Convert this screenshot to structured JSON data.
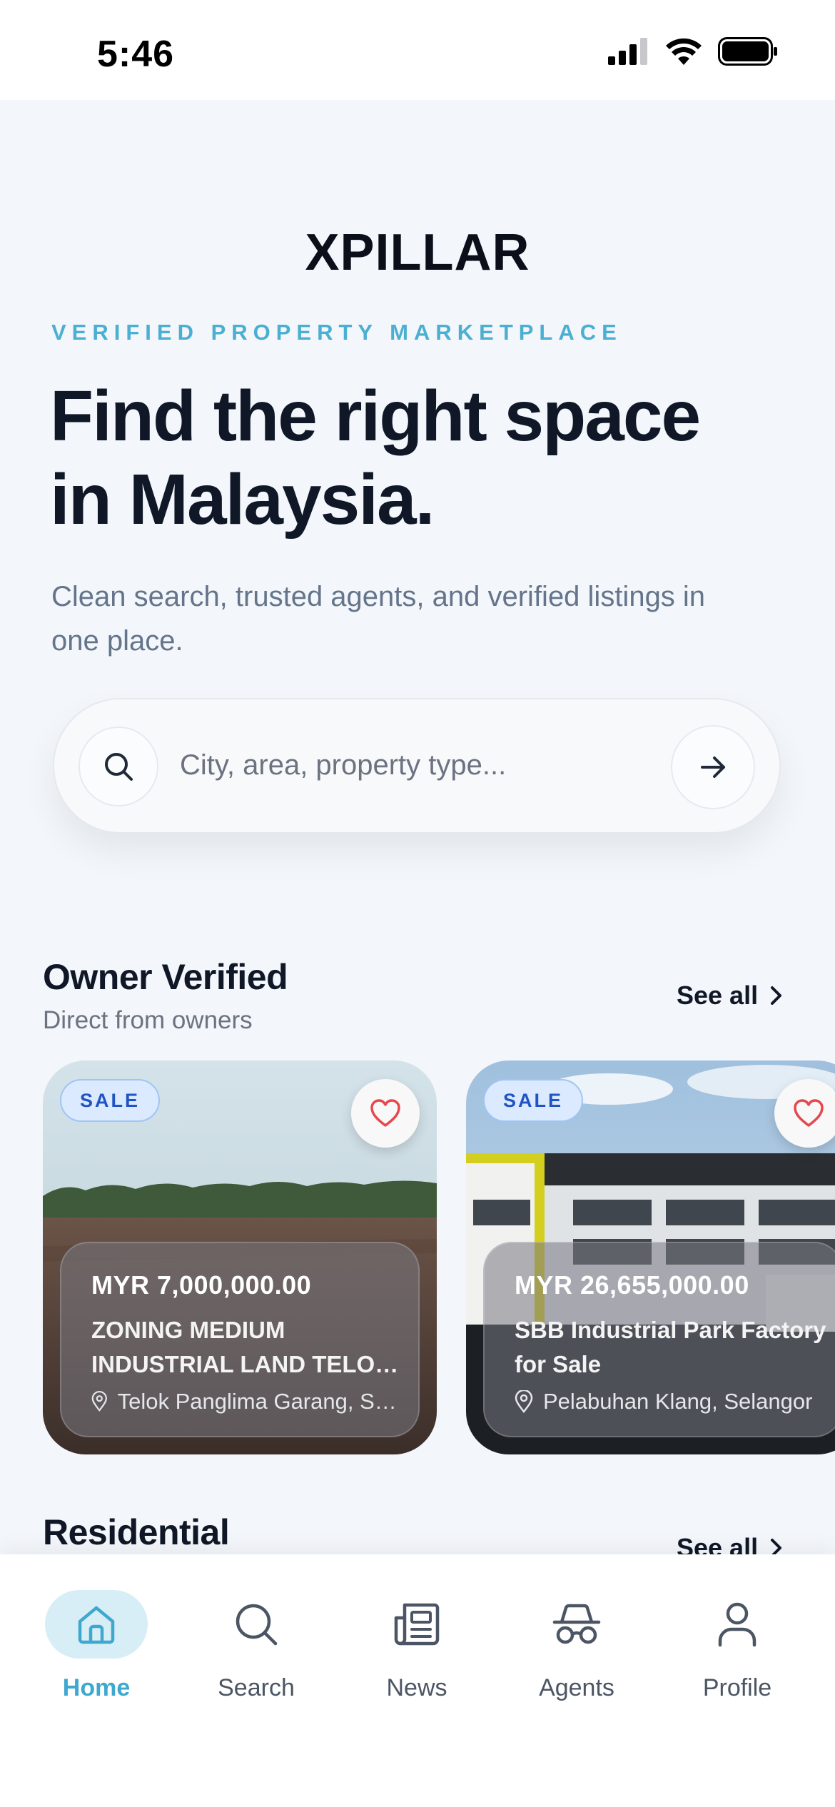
{
  "status_bar": {
    "time": "5:46"
  },
  "hero": {
    "logo_text": "XPILLAR",
    "eyebrow": "VERIFIED PROPERTY MARKETPLACE",
    "headline_line1": "Find the right space",
    "headline_line2": "in Malaysia.",
    "subtext": "Clean search, trusted agents, and verified listings in one place.",
    "search_placeholder": "City, area, property type..."
  },
  "owner_verified": {
    "title": "Owner Verified",
    "subtitle": "Direct from owners",
    "see_all": "See all",
    "listings": [
      {
        "badge": "SALE",
        "price": "MYR 7,000,000.00",
        "title": "ZONING MEDIUM INDUSTRIAL LAND TELOK PANGLIMA GARANG",
        "location": "Telok Panglima Garang, Selangor"
      },
      {
        "badge": "SALE",
        "price": "MYR 26,655,000.00",
        "title": "SBB Industrial Park Factory for Sale",
        "location": "Pelabuhan Klang, Selangor"
      }
    ]
  },
  "residential": {
    "title": "Residential",
    "see_all": "See all"
  },
  "tabbar": {
    "items": [
      {
        "label": "Home",
        "icon": "home-icon",
        "active": true
      },
      {
        "label": "Search",
        "icon": "search-icon",
        "active": false
      },
      {
        "label": "News",
        "icon": "newspaper-icon",
        "active": false
      },
      {
        "label": "Agents",
        "icon": "agent-incognito-icon",
        "active": false
      },
      {
        "label": "Profile",
        "icon": "user-icon",
        "active": false
      }
    ]
  },
  "colors": {
    "accent": "#3fa8cf",
    "eyebrow": "#4bafd2",
    "headline": "#101828",
    "muted": "#64748b",
    "badge_bg": "#dbeafe",
    "badge_text": "#2053c4",
    "heart": "#e5484d"
  }
}
